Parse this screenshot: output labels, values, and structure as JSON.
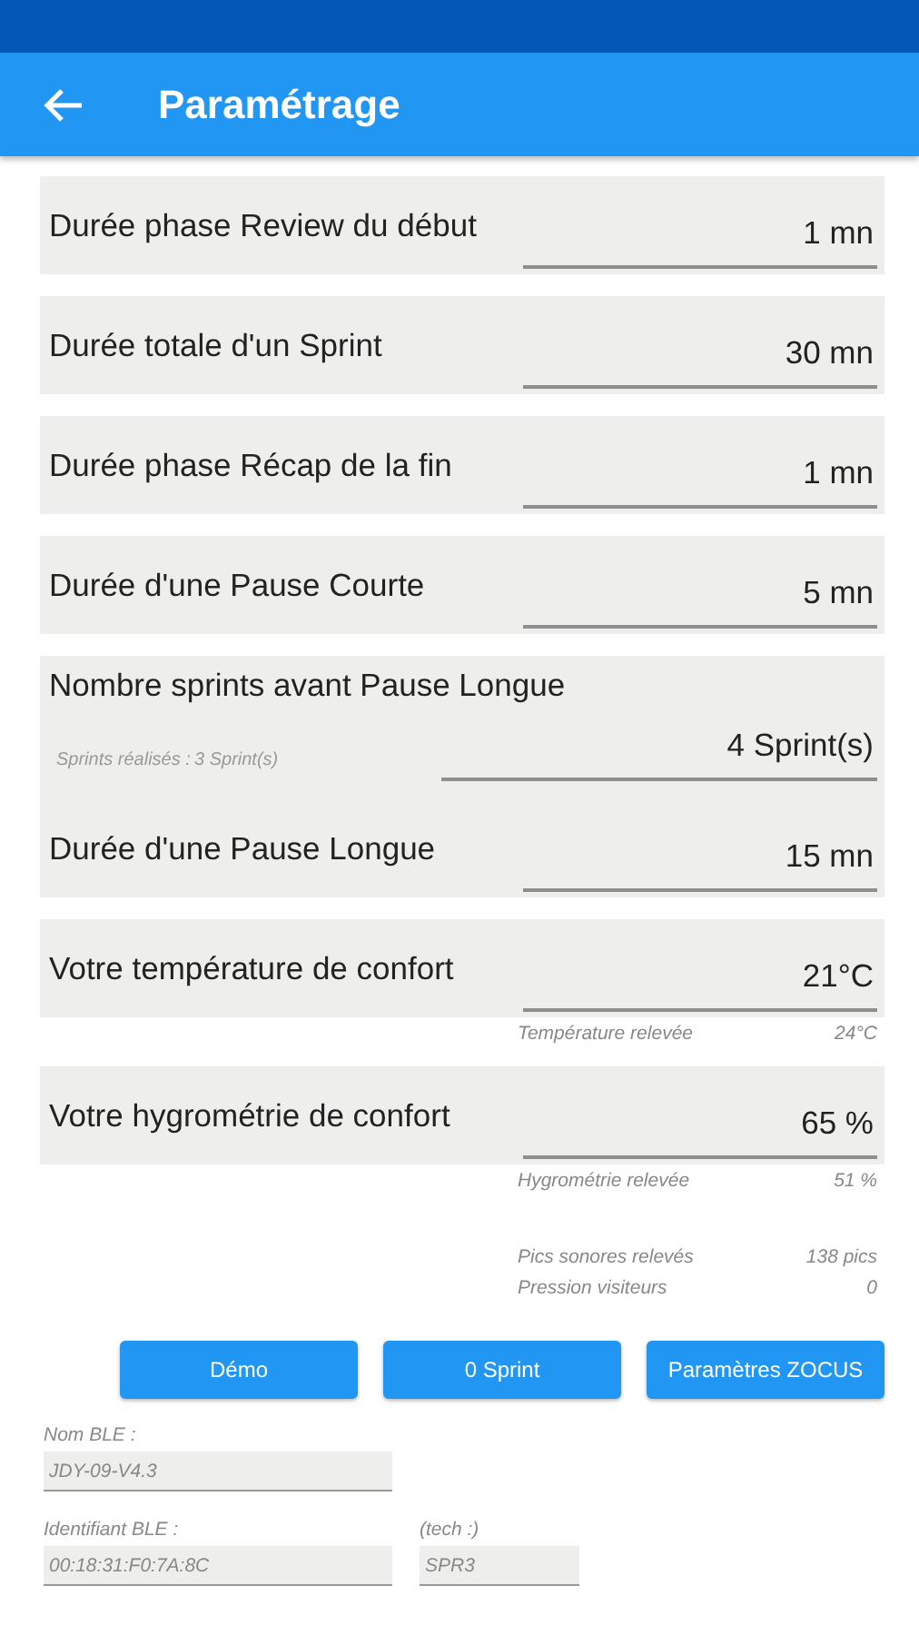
{
  "app_bar": {
    "title": "Paramétrage"
  },
  "settings": [
    {
      "kind": "plain",
      "label": "Durée phase Review du début",
      "value": "1 mn"
    },
    {
      "kind": "plain",
      "label": "Durée totale d'un Sprint",
      "value": "30 mn"
    },
    {
      "kind": "plain",
      "label": "Durée phase Récap de la fin",
      "value": "1 mn"
    },
    {
      "kind": "plain",
      "label": "Durée d'une Pause Courte",
      "value": "5 mn"
    },
    {
      "kind": "reading_inside",
      "label": "Nombre sprints avant Pause Longue",
      "value": "4 Sprint(s)",
      "reading": {
        "label": "Sprints réalisés :",
        "value": "3 Sprint(s)"
      }
    },
    {
      "kind": "plain",
      "label": "Durée d'une Pause Longue",
      "value": "15 mn"
    },
    {
      "kind": "reading_below",
      "label": "Votre température de confort",
      "value": "21°C",
      "reading": {
        "label": "Température relevée",
        "value": "24°C"
      }
    },
    {
      "kind": "reading_below",
      "label": "Votre hygrométrie de confort",
      "value": "65 %",
      "reading": {
        "label": "Hygrométrie relevée",
        "value": "51 %"
      }
    }
  ],
  "measurements": [
    {
      "label": "Pics sonores relevés",
      "value": "138 pics"
    },
    {
      "label": "Pression visiteurs",
      "value": "0"
    }
  ],
  "buttons": [
    "Démo",
    "0 Sprint",
    "Paramètres ZOCUS"
  ],
  "ble": {
    "name_label": "Nom BLE :",
    "name_value": "JDY-09-V4.3",
    "id_label": "Identifiant BLE :",
    "id_value": "00:18:31:F0:7A:8C",
    "tech_label": "(tech :)",
    "tech_value": "SPR3"
  }
}
